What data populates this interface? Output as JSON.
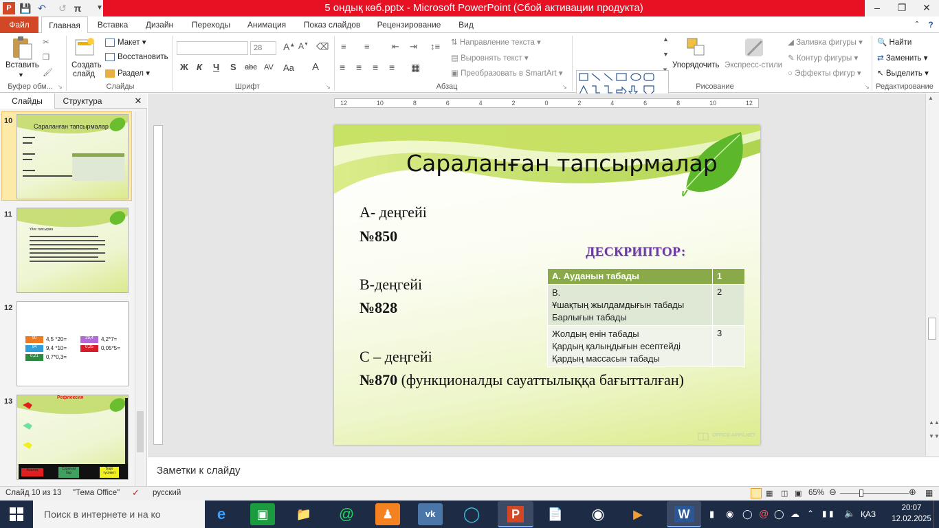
{
  "window": {
    "title": "5 ондық көб.pptx  -  Microsoft PowerPoint (Сбой активации продукта)",
    "qa_redo_symbol": "π"
  },
  "ribbon_tabs": [
    "Файл",
    "Главная",
    "Вставка",
    "Дизайн",
    "Переходы",
    "Анимация",
    "Показ слайдов",
    "Рецензирование",
    "Вид"
  ],
  "ribbon": {
    "clipboard": {
      "paste": "Вставить",
      "label": "Буфер обм..."
    },
    "slides": {
      "create": "Создать",
      "create2": "слайд",
      "layout": "Макет",
      "reset": "Восстановить",
      "section": "Раздел",
      "label": "Слайды"
    },
    "font": {
      "size": "28",
      "label": "Шрифт",
      "bold": "Ж",
      "italic": "К",
      "underline": "Ч",
      "strike": "S",
      "abc": "abc",
      "spacing": "AV",
      "case": "Aa",
      "color": "A"
    },
    "paragraph": {
      "direction": "Направление текста",
      "align": "Выровнять текст",
      "smartart": "Преобразовать в SmartArt",
      "label": "Абзац"
    },
    "drawing": {
      "arrange": "Упорядочить",
      "styles": "Экспресс-стили",
      "fill": "Заливка фигуры",
      "outline": "Контур фигуры",
      "effects": "Эффекты фигур",
      "label": "Рисование"
    },
    "editing": {
      "find": "Найти",
      "replace": "Заменить",
      "select": "Выделить",
      "label": "Редактирование"
    }
  },
  "pane": {
    "tab_slides": "Слайды",
    "tab_outline": "Структура",
    "thumbs": [
      {
        "num": "10",
        "title": "Сараланған тапсырмалар"
      },
      {
        "num": "11",
        "title": "Үйге тапсырма"
      },
      {
        "num": "12",
        "cells": [
          "90",
          "4,5 *20=",
          "29,4",
          "4,2*7=",
          "94",
          "9,4 *10=",
          "0,25",
          "0,05*5=",
          "0,21",
          "0,7*0,3="
        ]
      },
      {
        "num": "13",
        "title": "Рефлексия",
        "labels": [
          "Анализ",
          "Сұрағым бар",
          "Барі түсінікті"
        ]
      }
    ]
  },
  "slide": {
    "title": "Сараланған тапсырмалар",
    "level_a": "А- деңгейі",
    "num_a": "№850",
    "level_b": "В-деңгейі",
    "num_b": "№828",
    "level_c": "С – деңгейі",
    "num_c": "№870",
    "num_c_rest": " (функционалды сауаттылыққа бағытталған)",
    "descriptor_title": "ДЕСКРИПТОР:",
    "table": [
      {
        "desc": "А. Ауданын табады",
        "score": "1"
      },
      {
        "desc_lines": [
          "В.",
          "Ұшақтың жылдамдығын табады",
          "Барлығын табады"
        ],
        "score": "2"
      },
      {
        "desc_lines": [
          "Жолдың енін табады",
          "Қардың қалыңдығын есептейді",
          "Қардың массасын табады"
        ],
        "score": "3"
      }
    ],
    "watermark": "OFFICE-APPS.NET"
  },
  "ruler_labels": [
    "12",
    "10",
    "8",
    "6",
    "4",
    "2",
    "0",
    "2",
    "4",
    "6",
    "8",
    "10",
    "12"
  ],
  "notes_placeholder": "Заметки к слайду",
  "status": {
    "slide_info": "Слайд 10 из 13",
    "theme": "\"Тема Office\"",
    "language": "русский",
    "zoom": "65%"
  },
  "taskbar": {
    "search": "Поиск в интернете и на ко",
    "lang": "ҚАЗ",
    "time": "20:07",
    "date": "12.02.2025"
  }
}
